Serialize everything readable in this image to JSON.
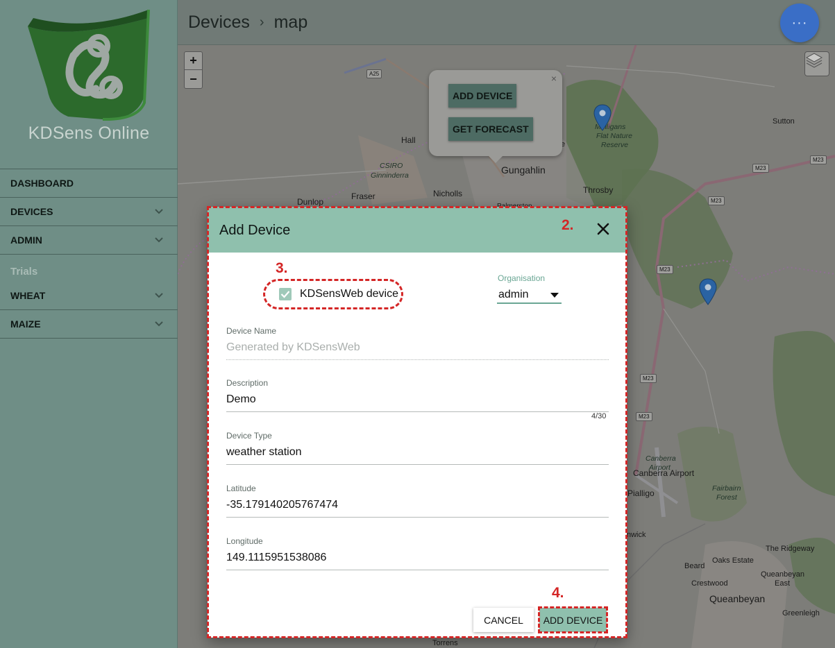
{
  "sidebar": {
    "brand": "KDSens Online",
    "items": [
      {
        "label": "DASHBOARD",
        "has_chevron": false
      },
      {
        "label": "DEVICES",
        "has_chevron": true
      },
      {
        "label": "ADMIN",
        "has_chevron": true
      }
    ],
    "trials_label": "Trials",
    "trial_items": [
      {
        "label": "WHEAT",
        "has_chevron": true
      },
      {
        "label": "MAIZE",
        "has_chevron": true
      }
    ]
  },
  "header": {
    "crumb_root": "Devices",
    "crumb_separator": "›",
    "crumb_current": "map",
    "fab_icon": "more-horizontal-icon",
    "fab_glyph": "···"
  },
  "map": {
    "zoom_in": "+",
    "zoom_out": "−",
    "layers_icon": "layers-icon",
    "popup": {
      "close": "×",
      "add_device": "ADD DEVICE",
      "get_forecast": "GET FORECAST"
    },
    "labels": {
      "a25": "A25",
      "hall": "Hall",
      "csiro": "CSIRO",
      "ginninderra": "Ginninderra",
      "gungahlin": "Gungahlin",
      "nicholls": "Nicholls",
      "throsby": "Throsby",
      "dunlop": "Dunlop",
      "fraser": "Fraser",
      "palmerston": "Palmerston",
      "mulligans1": "Mulligans",
      "mulligans2": "Flat Nature",
      "mulligans3": "Reserve",
      "sutton": "Sutton",
      "m23a": "M23",
      "m23b": "M23",
      "m23c": "M23",
      "m23d": "M23",
      "m23e": "M23",
      "m23f": "M23",
      "canberra_airport": "Canberra Airport",
      "canberra_airport_it1": "Canberra",
      "canberra_airport_it2": "Airport",
      "pialligo": "Pialligo",
      "fairbairn1": "Fairbairn",
      "fairbairn2": "Forest",
      "the_ridgeway": "The Ridgeway",
      "oaks_estate": "Oaks Estate",
      "beard": "Beard",
      "crestwood": "Crestwood",
      "queanbeyan_east1": "Queanbeyan",
      "queanbeyan_east2": "East",
      "queanbeyan": "Queanbeyan",
      "greenleigh": "Greenleigh",
      "torrens": "Torrens",
      "nwick": "nwick",
      "e_label": "e"
    },
    "colors": {
      "map_bg": "#7d7d79",
      "forest": "#5d7251",
      "motorway": "#8a6873",
      "marker": "#2a63a3"
    }
  },
  "dialog": {
    "title": "Add Device",
    "close": "×",
    "anno_2": "2.",
    "anno_3": "3.",
    "anno_4": "4.",
    "checkbox_label": "KDSensWeb device",
    "checkbox_checked": true,
    "organisation_label": "Organisation",
    "organisation_value": "admin",
    "fields": {
      "device_name": {
        "label": "Device Name",
        "placeholder": "Generated by KDSensWeb",
        "value": ""
      },
      "description": {
        "label": "Description",
        "value": "Demo",
        "counter": "4/30"
      },
      "device_type": {
        "label": "Device Type",
        "value": "weather station"
      },
      "latitude": {
        "label": "Latitude",
        "value": "-35.179140205767474"
      },
      "longitude": {
        "label": "Longitude",
        "value": "149.1115951538086"
      }
    },
    "cancel_label": "CANCEL",
    "add_label": "ADD DEVICE",
    "colors": {
      "header": "#8fc0ad",
      "accent": "#6aa694",
      "annotation": "#d42626"
    }
  }
}
